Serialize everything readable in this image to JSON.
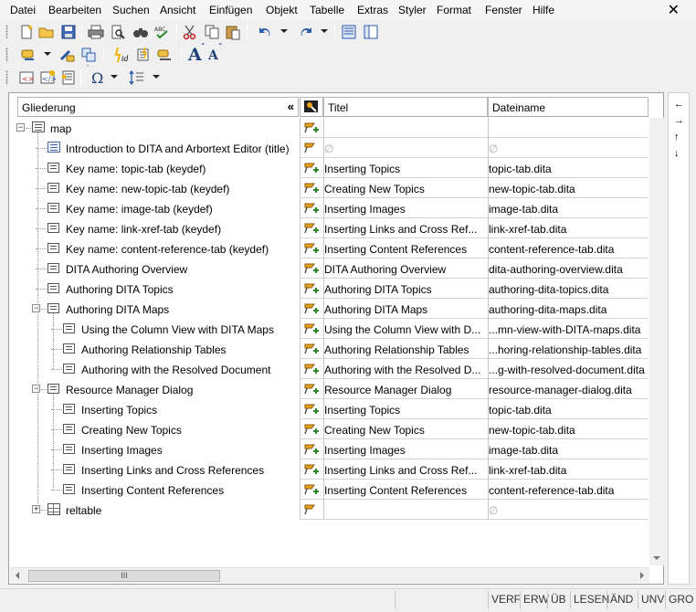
{
  "menu": [
    "Datei",
    "Bearbeiten",
    "Suchen",
    "Ansicht",
    "Einfügen",
    "Objekt",
    "Tabelle",
    "Extras",
    "Styler",
    "Format",
    "Fenster",
    "Hilfe"
  ],
  "close_symbol": "✕",
  "headers": {
    "outline": "Gliederung",
    "collapse": "«",
    "title": "Titel",
    "filename": "Dateiname"
  },
  "empty_symbol": "∅",
  "hscroll_grip": "III",
  "outline_nodes": [
    {
      "label": "map",
      "level": 0,
      "icon": "map-icon",
      "expander": "−"
    },
    {
      "label": "Introduction to DITA and Arbortext Editor (title)",
      "level": 1,
      "icon": "title-icon"
    },
    {
      "label": "Key name: topic-tab (keydef)",
      "level": 1,
      "icon": "document-icon"
    },
    {
      "label": "Key name: new-topic-tab (keydef)",
      "level": 1,
      "icon": "document-icon"
    },
    {
      "label": "Key name: image-tab (keydef)",
      "level": 1,
      "icon": "document-icon"
    },
    {
      "label": "Key name: link-xref-tab (keydef)",
      "level": 1,
      "icon": "document-icon"
    },
    {
      "label": "Key name: content-reference-tab (keydef)",
      "level": 1,
      "icon": "document-icon"
    },
    {
      "label": "DITA Authoring Overview",
      "level": 1,
      "icon": "document-icon"
    },
    {
      "label": "Authoring DITA Topics",
      "level": 1,
      "icon": "document-icon"
    },
    {
      "label": "Authoring DITA Maps",
      "level": 1,
      "icon": "document-icon",
      "expander": "−"
    },
    {
      "label": "Using the Column View with DITA Maps",
      "level": 2,
      "icon": "document-icon"
    },
    {
      "label": "Authoring Relationship Tables",
      "level": 2,
      "icon": "document-icon"
    },
    {
      "label": "Authoring with the Resolved Document",
      "level": 2,
      "icon": "document-icon"
    },
    {
      "label": "Resource Manager Dialog",
      "level": 1,
      "icon": "document-icon",
      "expander": "−"
    },
    {
      "label": "Inserting Topics",
      "level": 2,
      "icon": "document-icon"
    },
    {
      "label": "Creating New Topics",
      "level": 2,
      "icon": "document-icon"
    },
    {
      "label": "Inserting Images",
      "level": 2,
      "icon": "document-icon"
    },
    {
      "label": "Inserting Links and Cross References",
      "level": 2,
      "icon": "document-icon"
    },
    {
      "label": "Inserting Content References",
      "level": 2,
      "icon": "document-icon"
    },
    {
      "label": "reltable",
      "level": 1,
      "icon": "reltable-icon",
      "expander": "+"
    }
  ],
  "grid_rows": [
    {
      "icon": "key-add-icon",
      "title": "",
      "file": ""
    },
    {
      "icon": "key-icon",
      "title": "∅",
      "file": "∅"
    },
    {
      "icon": "key-add-icon",
      "title": "Inserting Topics",
      "file": "topic-tab.dita"
    },
    {
      "icon": "key-add-icon",
      "title": "Creating New Topics",
      "file": "new-topic-tab.dita"
    },
    {
      "icon": "key-add-icon",
      "title": "Inserting Images",
      "file": "image-tab.dita"
    },
    {
      "icon": "key-add-icon",
      "title": "Inserting Links and Cross Ref...",
      "file": "link-xref-tab.dita"
    },
    {
      "icon": "key-add-icon",
      "title": "Inserting Content References",
      "file": "content-reference-tab.dita"
    },
    {
      "icon": "key-add-icon",
      "title": "DITA Authoring Overview",
      "file": "dita-authoring-overview.dita"
    },
    {
      "icon": "key-add-icon",
      "title": "Authoring DITA Topics",
      "file": "authoring-dita-topics.dita"
    },
    {
      "icon": "key-add-icon",
      "title": "Authoring DITA Maps",
      "file": "authoring-dita-maps.dita"
    },
    {
      "icon": "key-add-icon",
      "title": "Using the Column View with D...",
      "file": "...mn-view-with-DITA-maps.dita"
    },
    {
      "icon": "key-add-icon",
      "title": "Authoring Relationship Tables",
      "file": "...horing-relationship-tables.dita"
    },
    {
      "icon": "key-add-icon",
      "title": "Authoring with the Resolved D...",
      "file": "...g-with-resolved-document.dita"
    },
    {
      "icon": "key-add-icon",
      "title": "Resource Manager Dialog",
      "file": "resource-manager-dialog.dita"
    },
    {
      "icon": "key-add-icon",
      "title": "Inserting Topics",
      "file": "topic-tab.dita"
    },
    {
      "icon": "key-add-icon",
      "title": "Creating New Topics",
      "file": "new-topic-tab.dita"
    },
    {
      "icon": "key-add-icon",
      "title": "Inserting Images",
      "file": "image-tab.dita"
    },
    {
      "icon": "key-add-icon",
      "title": "Inserting Links and Cross Ref...",
      "file": "link-xref-tab.dita"
    },
    {
      "icon": "key-add-icon",
      "title": "Inserting Content References",
      "file": "content-reference-tab.dita"
    },
    {
      "icon": "key-icon",
      "title": "",
      "file": "∅"
    }
  ],
  "side_arrows": [
    "←",
    "→",
    "↑",
    "↓"
  ],
  "status": [
    "VERF",
    "ERW",
    "ÜB",
    "LESEN",
    "ÄND",
    "UNV",
    "GRO"
  ],
  "colors": {
    "accent_key": "#e8a21c",
    "add_green": "#2a8a2a",
    "toolbar_blue": "#2b5aa8"
  }
}
